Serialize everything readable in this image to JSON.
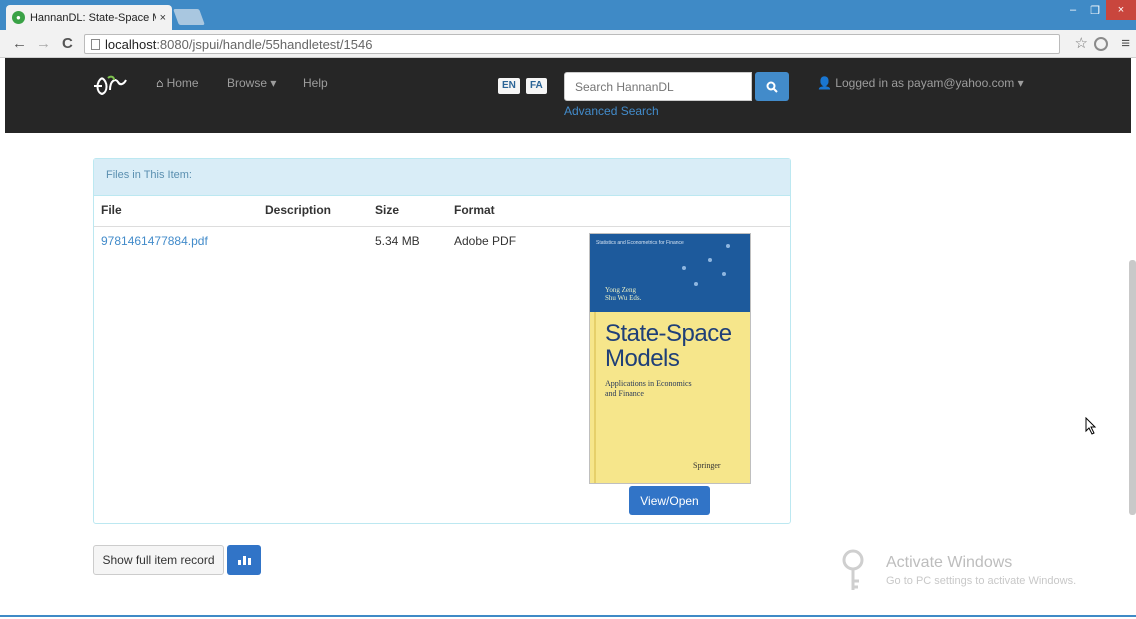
{
  "browser": {
    "tab_title": "HannanDL: State-Space M",
    "tab_close": "×",
    "url_host": "localhost",
    "url_rest": ":8080/jspui/handle/55handletest/1546",
    "back": "←",
    "forward": "→",
    "reload": "C",
    "star": "☆",
    "menu": "≡",
    "minimize": "–",
    "restore": "❐",
    "close": "×"
  },
  "navbar": {
    "home": "Home",
    "browse": "Browse",
    "help": "Help",
    "lang_en": "EN",
    "lang_fa": "FA",
    "search_placeholder": "Search HannanDL",
    "advanced_search": "Advanced Search",
    "user": "Logged in as payam@yahoo.com"
  },
  "files_panel": {
    "heading": "Files in This Item:",
    "columns": [
      "File",
      "Description",
      "Size",
      "Format"
    ],
    "rows": [
      {
        "file": "9781461477884.pdf",
        "description": "",
        "size": "5.34 MB",
        "format": "Adobe PDF"
      }
    ],
    "view_button": "View/Open"
  },
  "cover": {
    "series": "Statistics and Econometrics for Finance",
    "authors_line1": "Yong Zeng",
    "authors_line2": "Shu Wu  Eds.",
    "title_line1": "State-Space",
    "title_line2": "Models",
    "subtitle_line1": "Applications in Economics",
    "subtitle_line2": "and Finance",
    "publisher": "Springer"
  },
  "actions": {
    "full_record": "Show full item record"
  },
  "watermark": {
    "title": "Activate Windows",
    "subtitle": "Go to PC settings to activate Windows."
  }
}
